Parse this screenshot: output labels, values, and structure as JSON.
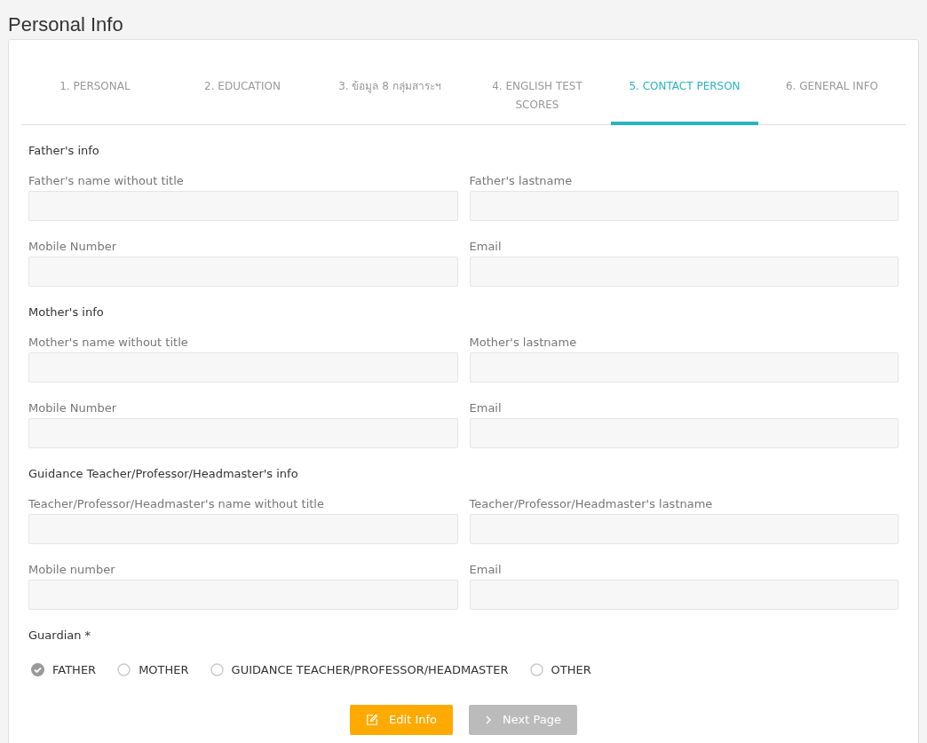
{
  "page_title": "Personal Info",
  "tabs": [
    {
      "label": "1. PERSONAL",
      "selected": false
    },
    {
      "label": "2. EDUCATION",
      "selected": false
    },
    {
      "label": "3. ข้อมูล 8 กลุ่มสาระฯ",
      "selected": false
    },
    {
      "label": "4. ENGLISH TEST SCORES",
      "selected": false
    },
    {
      "label": "5. CONTACT PERSON",
      "selected": true
    },
    {
      "label": "6. GENERAL INFO",
      "selected": false
    }
  ],
  "sections": [
    {
      "title": "Father's info",
      "fields": [
        {
          "label": "Father's name without title"
        },
        {
          "label": "Father's lastname"
        },
        {
          "label": "Mobile Number"
        },
        {
          "label": "Email"
        }
      ]
    },
    {
      "title": "Mother's info",
      "fields": [
        {
          "label": "Mother's name without title"
        },
        {
          "label": "Mother's lastname"
        },
        {
          "label": "Mobile Number"
        },
        {
          "label": "Email"
        }
      ]
    },
    {
      "title": "Guidance Teacher/Professor/Headmaster's info",
      "fields": [
        {
          "label": "Teacher/Professor/Headmaster's name without title"
        },
        {
          "label": "Teacher/Professor/Headmaster's lastname"
        },
        {
          "label": "Mobile number"
        },
        {
          "label": "Email"
        }
      ]
    }
  ],
  "guardian": {
    "label": "Guardian *",
    "options": [
      {
        "label": "FATHER",
        "selected": true
      },
      {
        "label": "MOTHER",
        "selected": false
      },
      {
        "label": "GUIDANCE TEACHER/PROFESSOR/HEADMASTER",
        "selected": false
      },
      {
        "label": "OTHER",
        "selected": false
      }
    ]
  },
  "buttons": [
    {
      "label": "Edit Info",
      "kind": "edit",
      "disabled": false
    },
    {
      "label": "Next Page",
      "kind": "next",
      "disabled": true
    }
  ]
}
